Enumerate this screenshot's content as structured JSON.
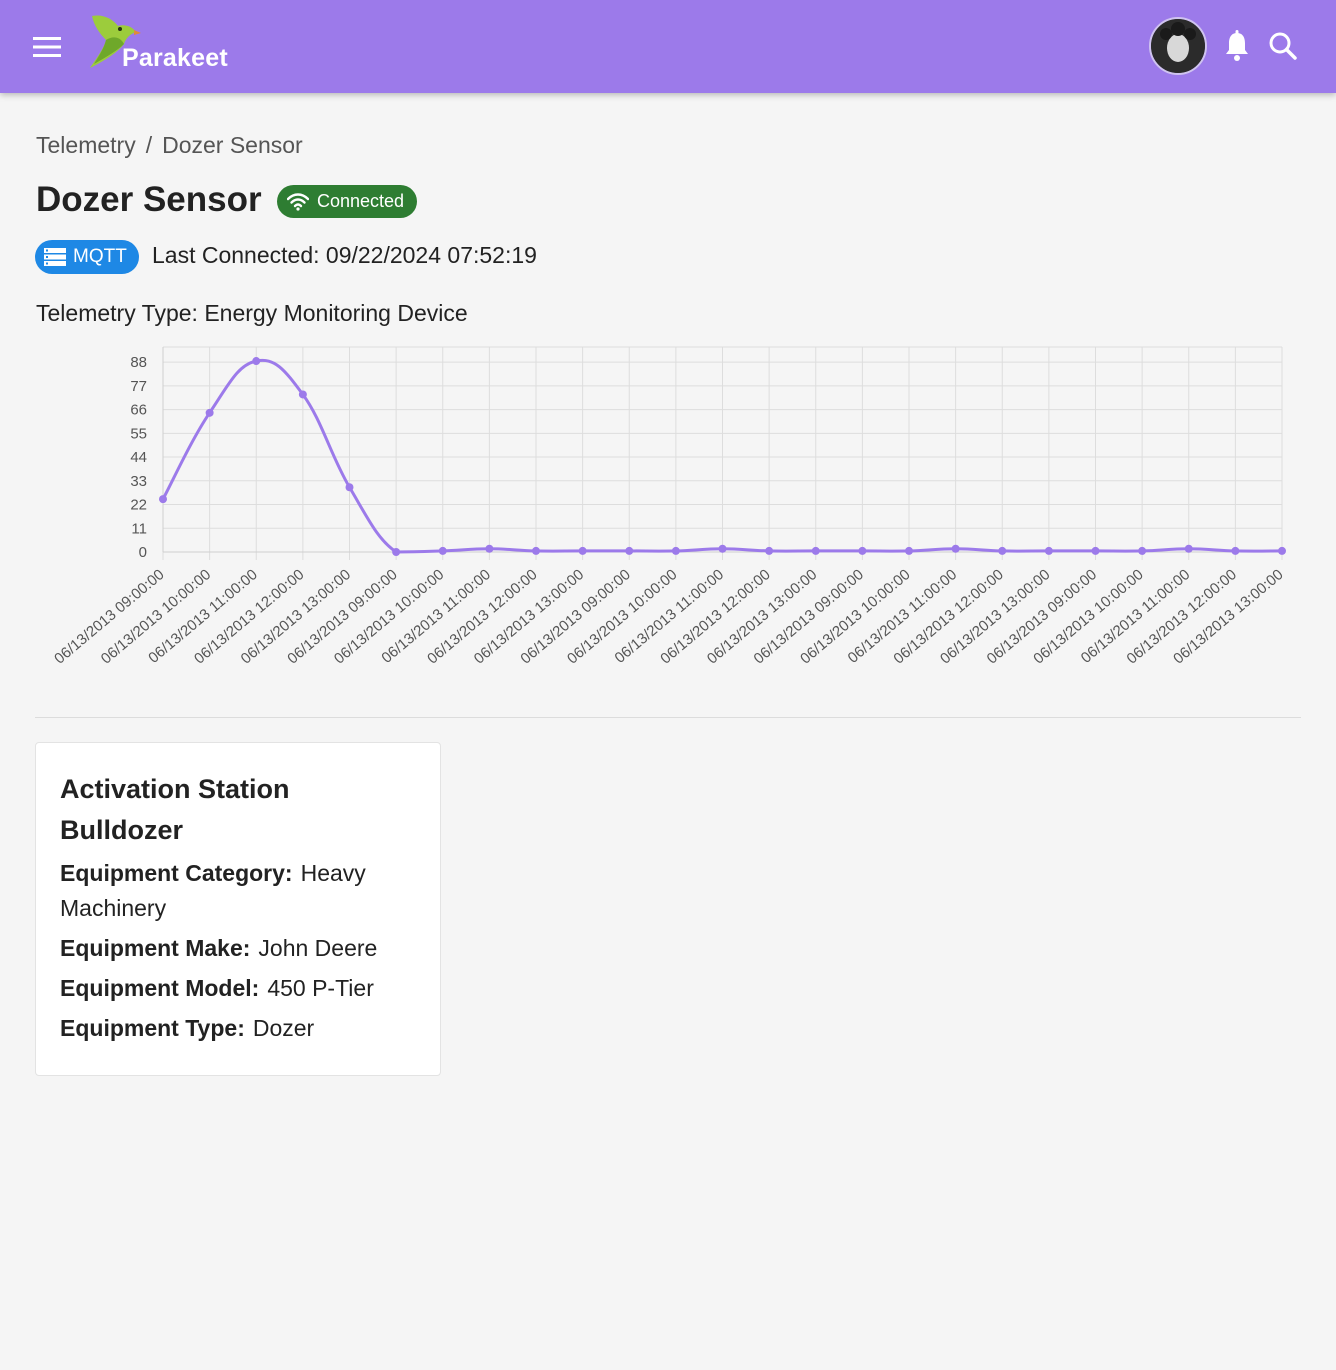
{
  "app": {
    "name": "Parakeet"
  },
  "breadcrumb": {
    "items": [
      "Telemetry",
      "Dozer Sensor"
    ],
    "separator": "/"
  },
  "device": {
    "name": "Dozer Sensor",
    "status": "Connected",
    "protocol": "MQTT",
    "last_connected_label": "Last Connected:",
    "last_connected": "09/22/2024 07:52:19",
    "telemetry_type_label": "Telemetry Type:",
    "telemetry_type": "Energy Monitoring Device"
  },
  "colors": {
    "appbar": "#9c7aea",
    "connected": "#2e7d32",
    "mqtt": "#1e88e5",
    "series": "#9c7aea"
  },
  "chart_data": {
    "type": "line",
    "x": [
      "06/13/2013 09:00:00",
      "06/13/2013 10:00:00",
      "06/13/2013 11:00:00",
      "06/13/2013 12:00:00",
      "06/13/2013 13:00:00",
      "06/13/2013 09:00:00",
      "06/13/2013 10:00:00",
      "06/13/2013 11:00:00",
      "06/13/2013 12:00:00",
      "06/13/2013 13:00:00",
      "06/13/2013 09:00:00",
      "06/13/2013 10:00:00",
      "06/13/2013 11:00:00",
      "06/13/2013 12:00:00",
      "06/13/2013 13:00:00",
      "06/13/2013 09:00:00",
      "06/13/2013 10:00:00",
      "06/13/2013 11:00:00",
      "06/13/2013 12:00:00",
      "06/13/2013 13:00:00",
      "06/13/2013 09:00:00",
      "06/13/2013 10:00:00",
      "06/13/2013 11:00:00",
      "06/13/2013 12:00:00",
      "06/13/2013 13:00:00"
    ],
    "series": [
      {
        "values": [
          24.5,
          64.5,
          88.5,
          73,
          30,
          0,
          0.5,
          1.5,
          0.5,
          0.5,
          0.5,
          0.5,
          1.5,
          0.5,
          0.5,
          0.5,
          0.5,
          1.5,
          0.5,
          0.5,
          0.5,
          0.5,
          1.5,
          0.5,
          0.5
        ]
      }
    ],
    "yticks": [
      0,
      11,
      22,
      33,
      44,
      55,
      66,
      77,
      88
    ],
    "ylim": [
      0,
      95
    ],
    "grid": true,
    "legend": "none"
  },
  "equipment": {
    "title": "Activation Station Bulldozer",
    "fields": [
      {
        "label": "Equipment Category:",
        "value": "Heavy Machinery"
      },
      {
        "label": "Equipment Make:",
        "value": "John Deere"
      },
      {
        "label": "Equipment Model:",
        "value": "450 P-Tier"
      },
      {
        "label": "Equipment Type:",
        "value": "Dozer"
      }
    ]
  },
  "icons": {
    "menu": "menu-icon",
    "notifications": "bell-icon",
    "search": "search-icon",
    "connected": "wifi-icon",
    "protocol": "server-icon"
  }
}
